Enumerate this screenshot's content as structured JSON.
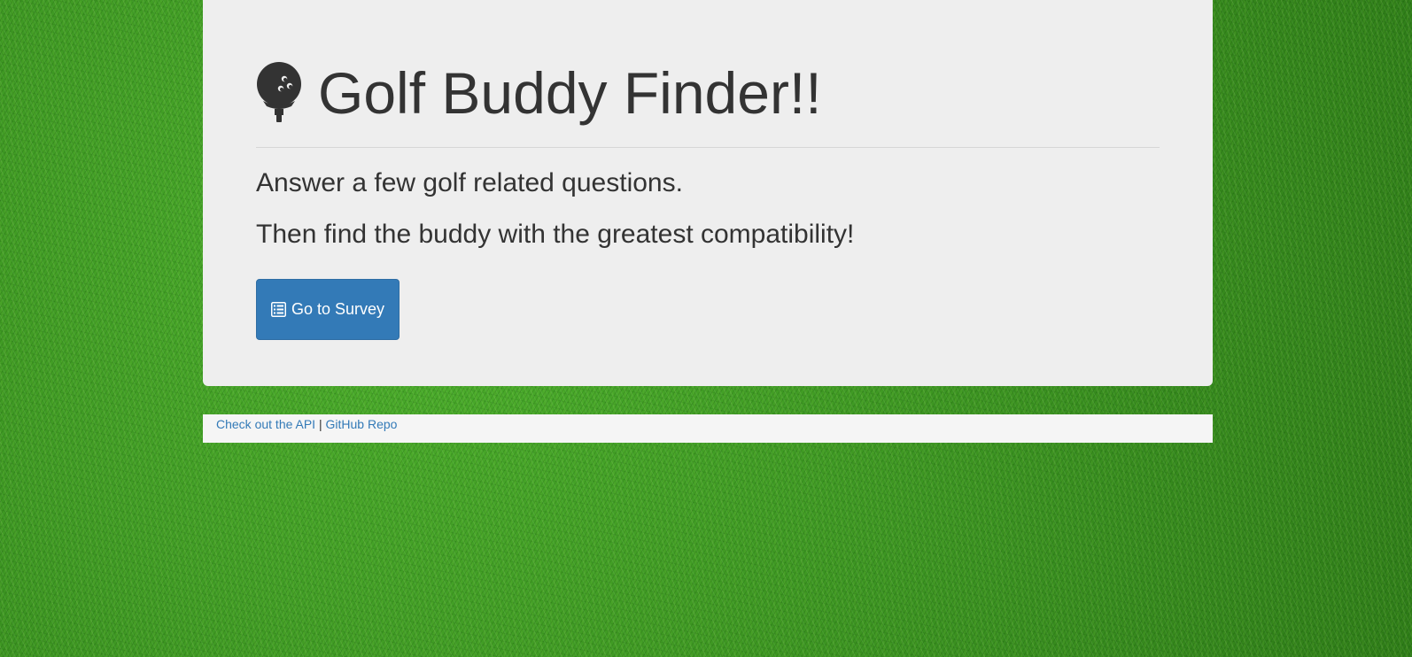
{
  "header": {
    "icon": "golf-tee-icon",
    "title": "Golf Buddy Finder!!"
  },
  "main": {
    "lead_1": "Answer a few golf related questions.",
    "lead_2": "Then find the buddy with the greatest compatibility!",
    "survey_button": {
      "icon": "list-alt-icon",
      "label": "Go to Survey"
    }
  },
  "footer": {
    "api_link": "Check out the API",
    "separator": "|",
    "repo_link": "GitHub Repo"
  },
  "colors": {
    "panel": "#eeeeee",
    "button": "#337ab7",
    "link": "#337ab7",
    "text": "#333333",
    "background": "#3f9a22"
  }
}
